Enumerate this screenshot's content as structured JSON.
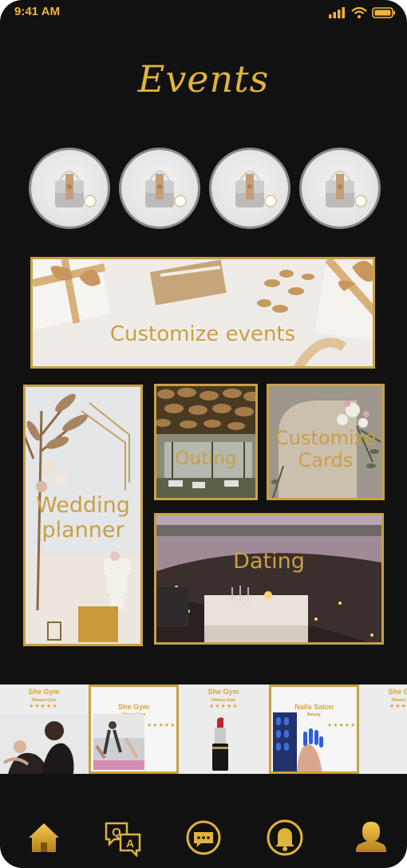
{
  "status": {
    "time": "9:41 AM"
  },
  "page": {
    "title": "Events"
  },
  "story_circles": [
    {
      "icon": "handbag-image"
    },
    {
      "icon": "handbag-image"
    },
    {
      "icon": "handbag-image"
    },
    {
      "icon": "handbag-image"
    }
  ],
  "cards": {
    "customize_events": "Customize events",
    "wedding_planner": {
      "line1": "Wedding",
      "line2": "planner"
    },
    "outing": "Outing",
    "customize_cards": {
      "line1": "Customize",
      "line2": "Cards"
    },
    "dating": "Dating"
  },
  "shops": [
    {
      "name": "She Gym",
      "type": "Fitness Gym",
      "stars": "★★★★★"
    },
    {
      "name": "She Gym",
      "type": "Fitness Gym",
      "stars": "★★★★★"
    },
    {
      "name": "She Gym",
      "type": "Fitness Gym",
      "stars": "★★★★★"
    },
    {
      "name": "Nails Salon",
      "type": "Beauty",
      "stars": "★★★★★"
    },
    {
      "name": "She Gym",
      "type": "Fitness Gym",
      "stars": "★★★★★"
    }
  ],
  "nav": [
    {
      "icon": "home-icon"
    },
    {
      "icon": "qa-icon"
    },
    {
      "icon": "chat-icon"
    },
    {
      "icon": "bell-icon"
    },
    {
      "icon": "profile-icon"
    }
  ],
  "colors": {
    "background": "#111111",
    "accent": "#c9a043",
    "accent_bright": "#e0b43a"
  }
}
